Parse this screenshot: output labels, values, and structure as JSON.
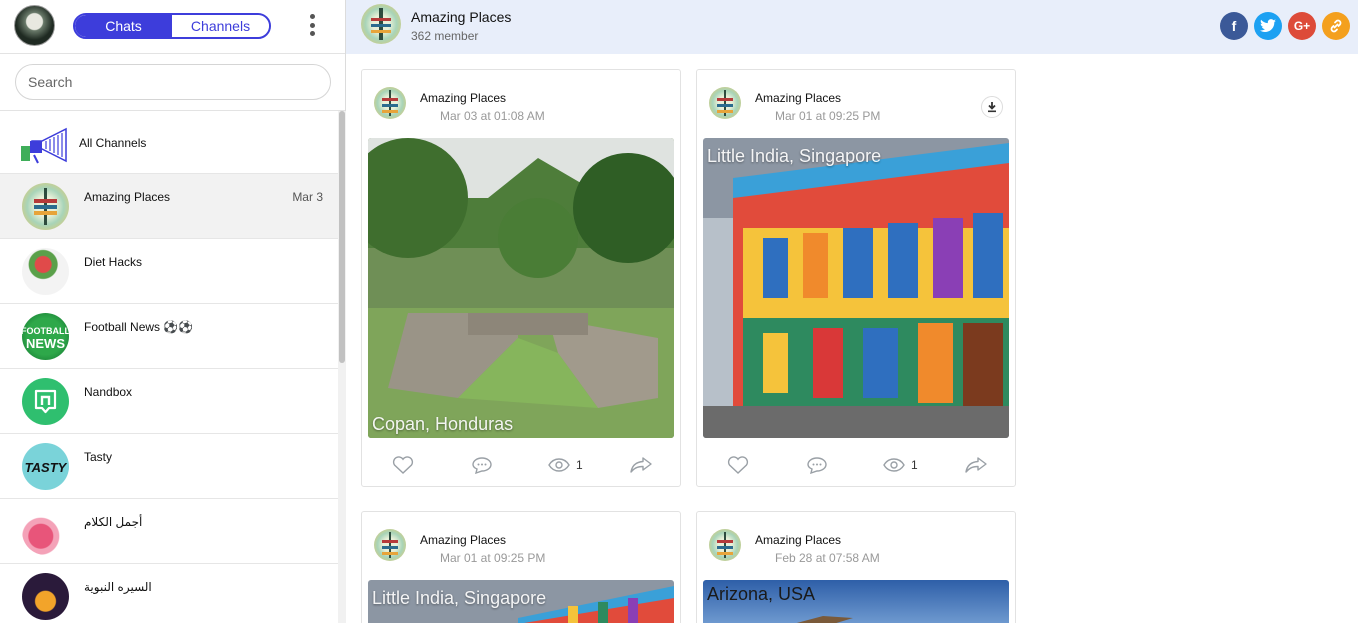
{
  "sidebar": {
    "toggle": {
      "chats_label": "Chats",
      "channels_label": "Channels"
    },
    "search": {
      "placeholder": "Search"
    },
    "all_channels_label": "All Channels",
    "channels": [
      {
        "name": "Amazing Places",
        "date": "Mar 3",
        "selected": true
      },
      {
        "name": "Diet Hacks",
        "date": ""
      },
      {
        "name": "Football News ⚽⚽",
        "date": ""
      },
      {
        "name": "Nandbox",
        "date": ""
      },
      {
        "name": "Tasty",
        "date": ""
      },
      {
        "name": "أجمل الكلام",
        "date": ""
      },
      {
        "name": "السيره النبوية",
        "date": ""
      }
    ]
  },
  "header": {
    "title": "Amazing Places",
    "subtitle": "362 member",
    "socials": [
      "facebook-icon",
      "twitter-icon",
      "google-plus-icon",
      "link-icon"
    ]
  },
  "posts": [
    {
      "channel": "Amazing Places",
      "date": "Mar 03 at 01:08 AM",
      "caption": "Copan, Honduras",
      "views": "1",
      "has_download": false
    },
    {
      "channel": "Amazing Places",
      "date": "Mar 01 at 09:25 PM",
      "caption": "Little India, Singapore",
      "views": "1",
      "has_download": true
    },
    {
      "channel": "Amazing Places",
      "date": "Mar 01 at 09:25 PM",
      "caption": "Little India, Singapore",
      "views": "",
      "has_download": false
    },
    {
      "channel": "Amazing Places",
      "date": "Feb 28 at 07:58 AM",
      "caption": "Arizona, USA",
      "views": "",
      "has_download": false
    }
  ],
  "colors": {
    "accent": "#3d3ddb",
    "header_bg": "#e8eefa",
    "facebook": "#3b5998",
    "twitter": "#1da1f2",
    "google_plus": "#dd4b39",
    "link": "#f4a01e"
  }
}
